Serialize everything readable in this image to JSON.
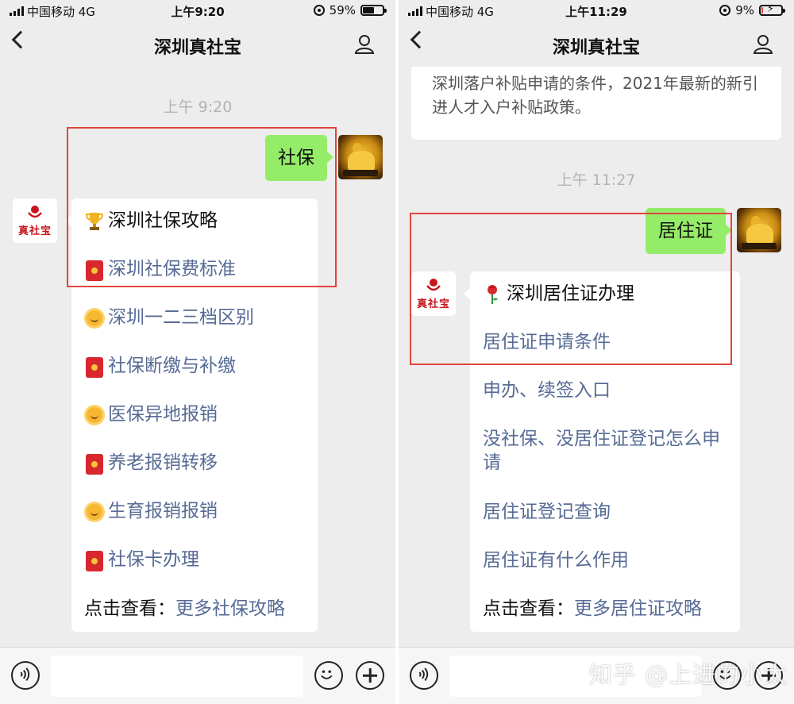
{
  "colors": {
    "bubble_me": "#95ec69",
    "link": "#576b95",
    "highlight_box": "#e0453a",
    "brand_red": "#c8161d"
  },
  "left": {
    "status": {
      "carrier": "中国移动 4G",
      "time": "上午9:20",
      "battery": "59%",
      "battery_level": 0.59
    },
    "nav": {
      "title": "深圳真社宝"
    },
    "timestamp": "上午 9:20",
    "my_message": "社保",
    "brand_avatar_text": "真社宝",
    "card": {
      "items": [
        {
          "icon": "trophy-icon",
          "label": "深圳社保攻略",
          "style": "plain"
        },
        {
          "icon": "red-envelope-icon",
          "label": "深圳社保费标准",
          "style": "link"
        },
        {
          "icon": "sun-icon",
          "label": "深圳一二三档区别",
          "style": "link"
        },
        {
          "icon": "red-envelope-icon",
          "label": "社保断缴与补缴",
          "style": "link"
        },
        {
          "icon": "sun-icon",
          "label": "医保异地报销",
          "style": "link"
        },
        {
          "icon": "red-envelope-icon",
          "label": "养老报销转移",
          "style": "link"
        },
        {
          "icon": "sun-icon",
          "label": "生育报销报销",
          "style": "link"
        },
        {
          "icon": "red-envelope-icon",
          "label": "社保卡办理",
          "style": "link"
        }
      ],
      "footer_prefix": "点击查看：",
      "footer_link": "更多社保攻略"
    }
  },
  "right": {
    "status": {
      "carrier": "中国移动 4G",
      "time": "上午11:29",
      "battery": "9%",
      "battery_level": 0.09
    },
    "nav": {
      "title": "深圳真社宝"
    },
    "prev_card_text": "深圳落户补贴申请的条件，2021年最新的新引进人才入户补贴政策。",
    "timestamp": "上午 11:27",
    "my_message": "居住证",
    "brand_avatar_text": "真社宝",
    "card": {
      "title_icon": "rose-icon",
      "title": "深圳居住证办理",
      "items": [
        "居住证申请条件",
        "申办、续签入口",
        "没社保、没居住证登记怎么申请",
        "居住证登记查询",
        "居住证有什么作用"
      ],
      "footer_prefix": "点击查看：",
      "footer_link": "更多居住证攻略"
    }
  },
  "watermark": "知乎 @上进的小太"
}
